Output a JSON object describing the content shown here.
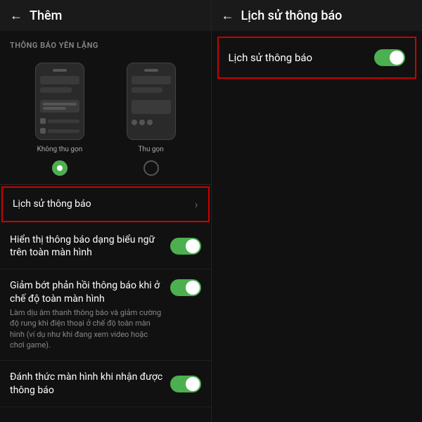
{
  "left_panel": {
    "header": {
      "back_label": "←",
      "title": "Thêm"
    },
    "section_label": "THÔNG BÁO YÊN LẶNG",
    "previews": [
      {
        "label": "Không thu gọn",
        "selected": true
      },
      {
        "label": "Thu gọn",
        "selected": false
      }
    ],
    "menu_items": [
      {
        "id": "lich-su",
        "text": "Lịch sử thông báo",
        "has_chevron": true,
        "has_toggle": false,
        "highlighted": true,
        "sub_text": ""
      },
      {
        "id": "hien-thi",
        "text": "Hiển thị thông báo dạng biểu ngữ trên toàn màn hình",
        "has_chevron": false,
        "has_toggle": true,
        "highlighted": false,
        "sub_text": ""
      },
      {
        "id": "giam-bot",
        "text": "Giảm bớt phản hồi thông báo khi ở chế độ toàn màn hình",
        "has_chevron": false,
        "has_toggle": true,
        "highlighted": false,
        "sub_text": "Làm dịu âm thanh thông báo và giảm cường độ rung khi điện thoại ở chế độ toàn màn hình (ví dụ như khi đang xem video hoặc chơi game)."
      },
      {
        "id": "danh-thuc",
        "text": "Đánh thức màn hình khi nhận được thông báo",
        "has_chevron": false,
        "has_toggle": true,
        "highlighted": false,
        "sub_text": ""
      }
    ]
  },
  "right_panel": {
    "header": {
      "back_label": "←",
      "title": "Lịch sử thông báo"
    },
    "item": {
      "text": "Lịch sử thông báo",
      "toggle_on": true,
      "highlighted": true
    }
  },
  "icons": {
    "chevron": "›",
    "back": "←"
  }
}
